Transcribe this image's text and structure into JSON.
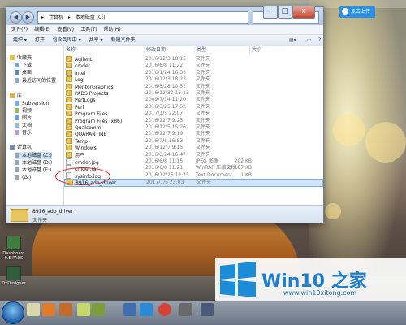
{
  "window": {
    "address_segments": [
      "计算机",
      "本地磁盘 (C:)"
    ],
    "menu": [
      "文件(F)",
      "编辑(E)",
      "查看(V)",
      "工具(T)",
      "帮助(H)"
    ],
    "toolbar": [
      "组织 ▾",
      "打开",
      "包含到库中 ▾",
      "共享 ▾",
      "新建文件夹"
    ],
    "columns": [
      "名称",
      "修改日期",
      "类型",
      "大小"
    ],
    "nav": [
      {
        "label": "收藏夹",
        "icon": "star-icon"
      },
      {
        "label": "下载",
        "icon": "download-icon"
      },
      {
        "label": "桌面",
        "icon": "desktop-icon"
      },
      {
        "label": "最近访问的位置",
        "icon": "recent-icon"
      },
      {
        "label": "库",
        "icon": "library-icon"
      },
      {
        "label": "Subversion",
        "icon": "subversion-icon"
      },
      {
        "label": "视频",
        "icon": "video-icon"
      },
      {
        "label": "图片",
        "icon": "picture-icon"
      },
      {
        "label": "文档",
        "icon": "document-icon"
      },
      {
        "label": "音乐",
        "icon": "music-icon"
      },
      {
        "label": "计算机",
        "icon": "computer-icon"
      },
      {
        "label": "本地磁盘 (C:)",
        "icon": "drive-icon"
      },
      {
        "label": "本地磁盘 (D:)",
        "icon": "drive-icon"
      },
      {
        "label": "本地磁盘 (E:)",
        "icon": "drive-icon"
      },
      {
        "label": "(G:)",
        "icon": "drive-icon"
      }
    ],
    "rows": [
      {
        "name": "Agilent",
        "date": "2016/12/3 18:15",
        "type": "文件夹",
        "size": "",
        "kind": "folder"
      },
      {
        "name": "cmder",
        "date": "2016/6/8 11:22",
        "type": "文件夹",
        "size": "",
        "kind": "folder"
      },
      {
        "name": "Intel",
        "date": "2016/1/24 16:30",
        "type": "文件夹",
        "size": "",
        "kind": "folder"
      },
      {
        "name": "Log",
        "date": "2016/12/3 18:23",
        "type": "文件夹",
        "size": "",
        "kind": "folder"
      },
      {
        "name": "MentorGraphics",
        "date": "2016/5/28 10:52",
        "type": "文件夹",
        "size": "",
        "kind": "folder"
      },
      {
        "name": "PADS Projects",
        "date": "2016/12/30 16:13",
        "type": "文件夹",
        "size": "",
        "kind": "folder"
      },
      {
        "name": "PerfLogs",
        "date": "2009/7/14 11:20",
        "type": "文件夹",
        "size": "",
        "kind": "folder"
      },
      {
        "name": "Perl",
        "date": "2016/3/25 17:52",
        "type": "文件夹",
        "size": "",
        "kind": "folder"
      },
      {
        "name": "Program Files",
        "date": "2017/1/5 22:07",
        "type": "文件夹",
        "size": "",
        "kind": "folder"
      },
      {
        "name": "Program Files (x86)",
        "date": "2016/12/7 9:25",
        "type": "文件夹",
        "size": "",
        "kind": "folder"
      },
      {
        "name": "Qualcomm",
        "date": "2016/12/5 15:26",
        "type": "文件夹",
        "size": "",
        "kind": "folder"
      },
      {
        "name": "QUARANTINE",
        "date": "2016/12/7 9:19",
        "type": "文件夹",
        "size": "",
        "kind": "folder"
      },
      {
        "name": "Temp",
        "date": "2016/7/6 16:53",
        "type": "文件夹",
        "size": "",
        "kind": "folder"
      },
      {
        "name": "Windows",
        "date": "2016/12/7 9:15",
        "type": "文件夹",
        "size": "",
        "kind": "folder"
      },
      {
        "name": "用户",
        "date": "2016/3/24 16:47",
        "type": "文件夹",
        "size": "",
        "kind": "folder"
      },
      {
        "name": "cmder.jpg",
        "date": "2016/6/8 11:15",
        "type": "JPEG 图像",
        "size": "202 KB",
        "kind": "file"
      },
      {
        "name": "cmder.rar",
        "date": "2016/6/8 11:21",
        "type": "WinRAR 压缩文件",
        "size": "69,187 KB",
        "kind": "file"
      },
      {
        "name": "sysinfo.log",
        "date": "2016/12/26 12:25",
        "type": "Text Document",
        "size": "1 KB",
        "kind": "file"
      },
      {
        "name": "8916_adb_driver",
        "date": "2017/1/5 23:03",
        "type": "文件夹",
        "size": "",
        "kind": "folder"
      }
    ],
    "details": {
      "name": "8916_adb_driver",
      "meta": "修改日期: 2017/1/5 23:03",
      "type": "文件夹"
    }
  },
  "badge": {
    "label": "点击上传"
  },
  "desktop_icons": [
    {
      "label": "Dashboard 9.5 PADS",
      "color": "#3e7d3a"
    },
    {
      "label": "DxDesigner",
      "color": "#2f5d3a"
    }
  ],
  "watermark": {
    "title": "Win10 之家",
    "url": "www.win10xitong.com"
  }
}
